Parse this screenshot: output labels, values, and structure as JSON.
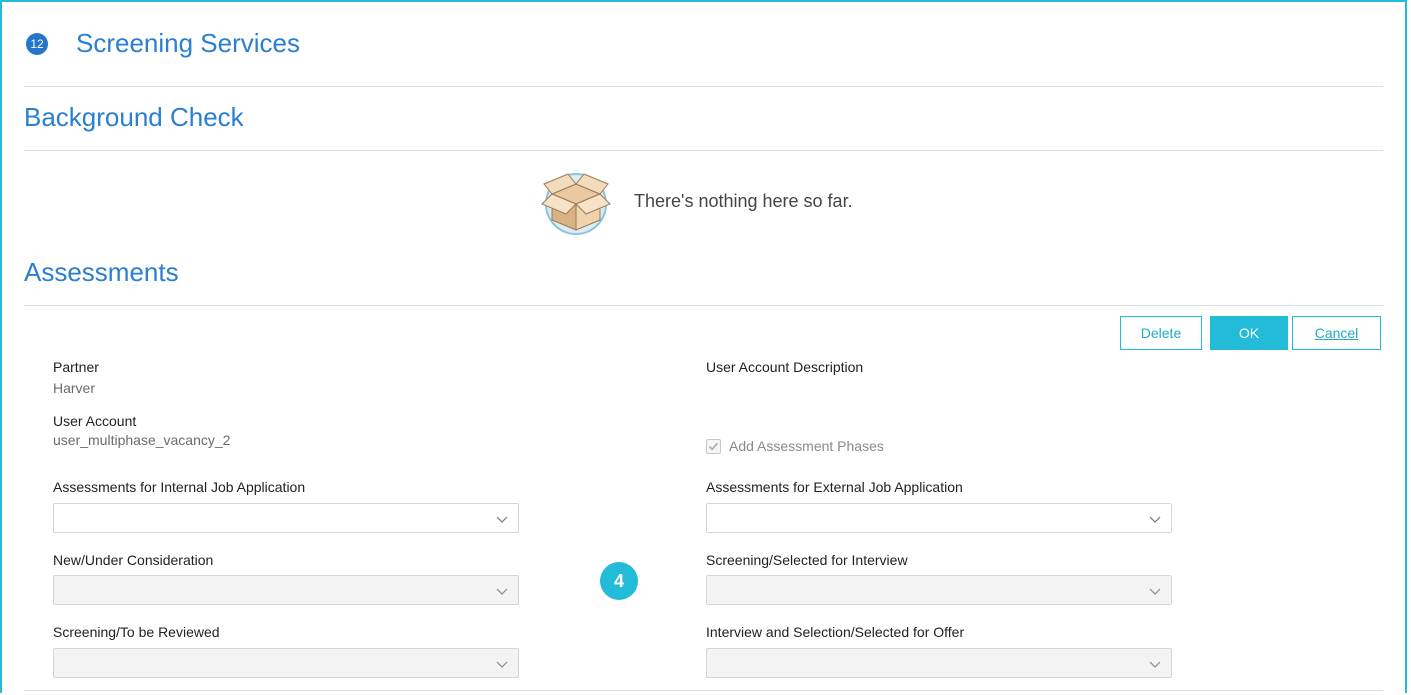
{
  "header": {
    "step_number": "12",
    "title": "Screening Services"
  },
  "background_check": {
    "title": "Background Check",
    "empty_message": "There's nothing here so far.",
    "empty_icon": "open-box-icon"
  },
  "assessments": {
    "title": "Assessments",
    "buttons": {
      "delete": "Delete",
      "ok": "OK",
      "cancel": "Cancel"
    },
    "partner_label": "Partner",
    "partner_value": "Harver",
    "user_account_label": "User Account",
    "user_account_value": "user_multiphase_vacancy_2",
    "user_account_description_label": "User Account Description",
    "add_phases": {
      "label": "Add Assessment Phases",
      "checked": true,
      "disabled": true
    },
    "fields": {
      "internal_label": "Assessments for Internal Job Application",
      "internal_value": "",
      "external_label": "Assessments for External Job Application",
      "external_value": "",
      "new_under_consideration_label": "New/Under Consideration",
      "screening_selected_label": "Screening/Selected for Interview",
      "screening_review_label": "Screening/To be Reviewed",
      "interview_offer_label": "Interview and Selection/Selected for Offer"
    },
    "step_badge": "4"
  },
  "colors": {
    "accent": "#22bcd8",
    "title_blue": "#2a7fd0",
    "badge_blue": "#2476c9"
  }
}
